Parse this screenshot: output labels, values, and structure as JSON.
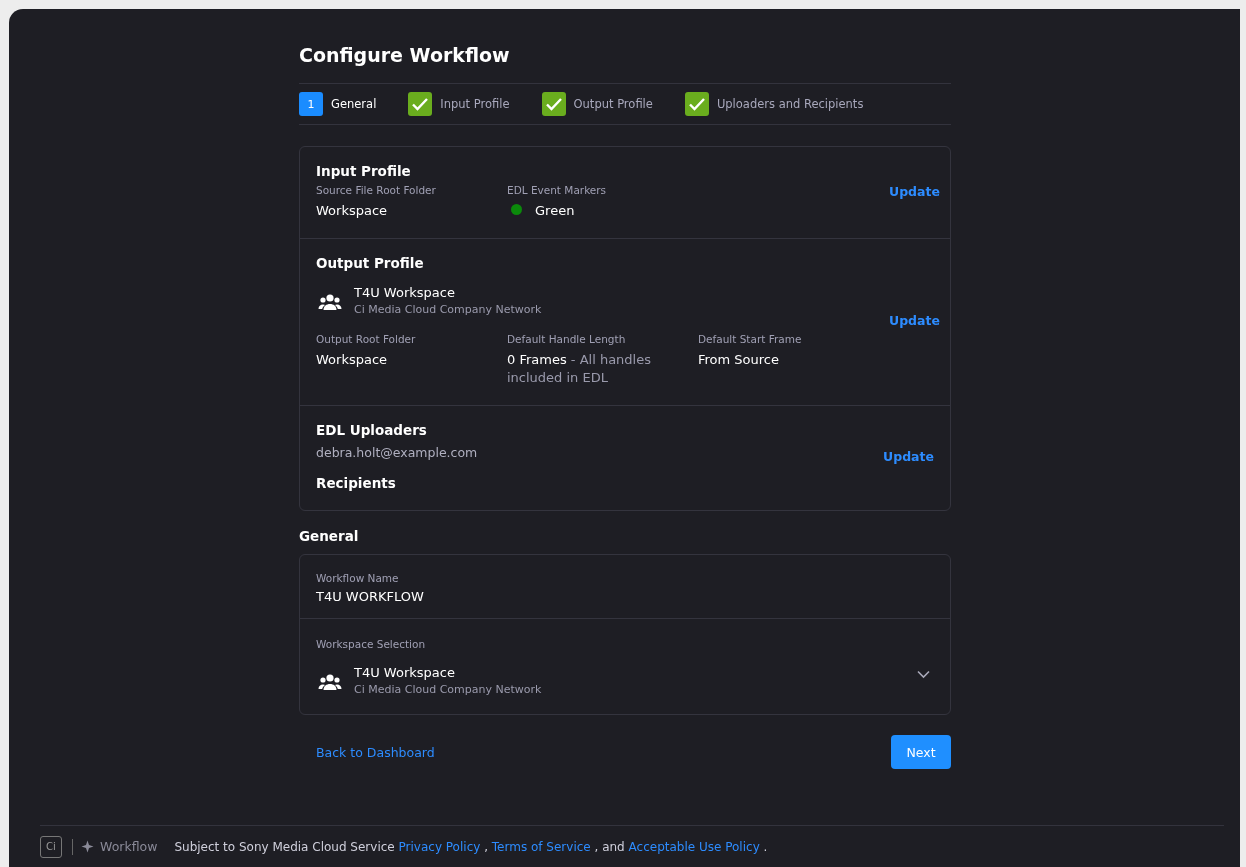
{
  "title": "Configure Workflow",
  "steps": [
    {
      "number": "1",
      "label": "General",
      "selected": true,
      "completed": false
    },
    {
      "label": "Input Profile",
      "selected": false,
      "completed": true
    },
    {
      "label": "Output Profile",
      "selected": false,
      "completed": true
    },
    {
      "label": "Uploaders and Recipients",
      "selected": false,
      "completed": true
    }
  ],
  "summary": [
    {
      "kind": "input",
      "heading": "Input Profile",
      "action": "Update",
      "fields": [
        {
          "label": "Source File Root Folder",
          "value": "Workspace"
        },
        {
          "label": "EDL Event Markers",
          "value": "Green",
          "color": "#0b8a0b"
        }
      ]
    },
    {
      "kind": "output",
      "heading": "Output Profile",
      "action": "Update",
      "workspace": {
        "name": "T4U Workspace",
        "network": "Ci Media Cloud Company Network"
      },
      "fields": [
        {
          "label": "Output Root Folder",
          "value": "Workspace"
        },
        {
          "label": "Default Handle Length",
          "value": "0 Frames",
          "note": "- All handles included in EDL"
        },
        {
          "label": "Default Start Frame",
          "value": "From Source"
        }
      ]
    },
    {
      "kind": "people",
      "heading": "EDL Uploaders",
      "action": "Update",
      "emails": [
        "debra.holt@example.com"
      ],
      "subheading": "Recipients"
    }
  ],
  "general": {
    "heading": "General",
    "workflow_name": {
      "label": "Workflow Name",
      "value": "T4U WORKFLOW"
    },
    "workspace_selection": {
      "label": "Workspace Selection",
      "name": "T4U Workspace",
      "network": "Ci Media Cloud Company Network"
    }
  },
  "back_link": "Back to Dashboard",
  "next_button": "Next",
  "footer": {
    "logo": "Ci",
    "product": "Workflow",
    "legal_intro": "Subject to Sony Media Cloud Service",
    "links": [
      {
        "text": "Privacy Policy",
        "suffix": ","
      },
      {
        "text": "Terms of Service",
        "suffix": ", and"
      },
      {
        "text": "Acceptable Use Policy",
        "suffix": "."
      }
    ]
  }
}
